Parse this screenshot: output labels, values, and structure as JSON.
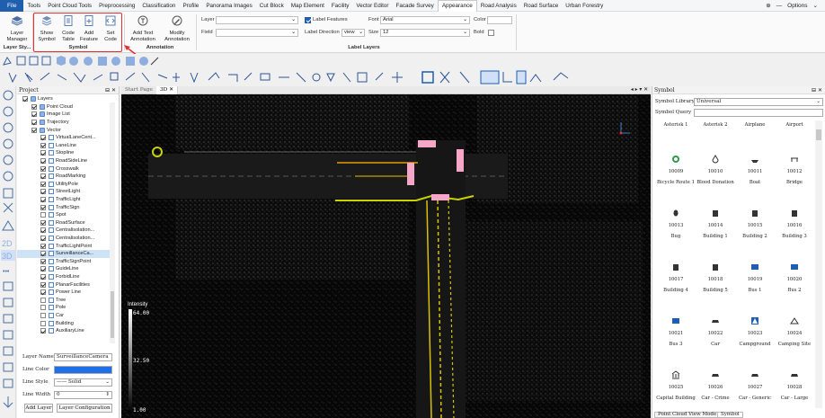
{
  "menubar": {
    "file": "File",
    "items": [
      "Tools",
      "Point Cloud Tools",
      "Preprocessing",
      "Classification",
      "Profile",
      "Panorama Images",
      "Cut Block",
      "Map Element",
      "Facility",
      "Vector Editor",
      "Facade Survey",
      "Appearance",
      "Road Analysis",
      "Road Surface",
      "Urban Forestry"
    ],
    "active": "Appearance",
    "options": "Options"
  },
  "ribbon": {
    "layer_manager": "Layer Manager",
    "layer_group": "Layer Sty...",
    "show_symbol": "Show Symbol",
    "code_table": "Code Table",
    "add_feature": "Add Feature",
    "set_code": "Set Code",
    "symbol_group": "Symbol",
    "add_text_annotation": "Add Text Annotation",
    "modify_annotation": "Modify Annotation",
    "annotation_group": "Annotation",
    "layer_label": "Layer",
    "field_label": "Field",
    "label_features": "Label Features",
    "label_direction": "Label Direction",
    "label_direction_value": "view",
    "font_label": "Font",
    "font_value": "Arial",
    "size_label": "Size",
    "size_value": "12",
    "color_label": "Color",
    "bold_label": "Bold",
    "layers_group": "Label Layers"
  },
  "project": {
    "title": "Project",
    "tree": [
      {
        "label": "Layers",
        "indent": 0,
        "checked": true
      },
      {
        "label": "Point Cloud",
        "indent": 1,
        "checked": true
      },
      {
        "label": "Image List",
        "indent": 1,
        "checked": true
      },
      {
        "label": "Trajectory",
        "indent": 1,
        "checked": true
      },
      {
        "label": "Vector",
        "indent": 1,
        "checked": true
      },
      {
        "label": "VirtualLaneCent...",
        "indent": 2,
        "checked": true
      },
      {
        "label": "LaneLine",
        "indent": 2,
        "checked": true
      },
      {
        "label": "Stopline",
        "indent": 2,
        "checked": true
      },
      {
        "label": "RoadSideLine",
        "indent": 2,
        "checked": true
      },
      {
        "label": "Crosswalk",
        "indent": 2,
        "checked": true
      },
      {
        "label": "RoadMarking",
        "indent": 2,
        "checked": true
      },
      {
        "label": "UtilityPole",
        "indent": 2,
        "checked": true
      },
      {
        "label": "StreetLight",
        "indent": 2,
        "checked": true
      },
      {
        "label": "TrafficLight",
        "indent": 2,
        "checked": true
      },
      {
        "label": "TrafficSign",
        "indent": 2,
        "checked": true
      },
      {
        "label": "Spot",
        "indent": 2,
        "checked": false
      },
      {
        "label": "RoadSurface",
        "indent": 2,
        "checked": true
      },
      {
        "label": "Centralisolation...",
        "indent": 2,
        "checked": true
      },
      {
        "label": "Centralisolation...",
        "indent": 2,
        "checked": true
      },
      {
        "label": "TrafficLightPoint",
        "indent": 2,
        "checked": true
      },
      {
        "label": "SurveillanceCa...",
        "indent": 2,
        "checked": true,
        "selected": true
      },
      {
        "label": "TrafficSignPoint",
        "indent": 2,
        "checked": true
      },
      {
        "label": "GuideLine",
        "indent": 2,
        "checked": true
      },
      {
        "label": "ForbidLine",
        "indent": 2,
        "checked": true
      },
      {
        "label": "PlanarFacilities",
        "indent": 2,
        "checked": true
      },
      {
        "label": "Power Line",
        "indent": 2,
        "checked": true
      },
      {
        "label": "Tree",
        "indent": 2,
        "checked": false
      },
      {
        "label": "Pole",
        "indent": 2,
        "checked": false
      },
      {
        "label": "Car",
        "indent": 2,
        "checked": false
      },
      {
        "label": "Building",
        "indent": 2,
        "checked": false
      },
      {
        "label": "AuxiliaryLine",
        "indent": 2,
        "checked": true
      }
    ],
    "layer_name_label": "Layer Name",
    "layer_name_value": "SurveillanceCamera",
    "line_color_label": "Line Color",
    "line_color": "#1e6fe8",
    "line_style_label": "Line Style",
    "line_style_value": "—— Solid",
    "line_width_label": "Line Width",
    "line_width_value": "0",
    "add_layer": "Add Layer",
    "layer_config": "Layer Configuration"
  },
  "viewer": {
    "tabs": [
      "Start Page",
      "3D"
    ],
    "active_tab": "3D",
    "intensity_label": "Intensity",
    "scale_top": "64.00",
    "scale_mid": "32.50",
    "scale_bottom": "1.00"
  },
  "symbol": {
    "title": "Symbol",
    "library_label": "Symbol Library",
    "library_value": "Universal",
    "query_label": "Symbol Query",
    "items": [
      {
        "code": "",
        "name": "Asterisk 1",
        "icon": "asterisk-icon"
      },
      {
        "code": "",
        "name": "Asterisk 2",
        "icon": "asterisk-icon"
      },
      {
        "code": "",
        "name": "Airplane",
        "icon": "airplane-icon"
      },
      {
        "code": "",
        "name": "Airport",
        "icon": "airport-icon"
      },
      {
        "code": "10009",
        "name": "Bicycle Route 1",
        "icon": "bicycle-icon"
      },
      {
        "code": "10010",
        "name": "Blood Donation",
        "icon": "blood-icon"
      },
      {
        "code": "10011",
        "name": "Boat",
        "icon": "boat-icon"
      },
      {
        "code": "10012",
        "name": "Bridge",
        "icon": "bridge-icon"
      },
      {
        "code": "10013",
        "name": "Bug",
        "icon": "bug-icon"
      },
      {
        "code": "10014",
        "name": "Building 1",
        "icon": "building-icon"
      },
      {
        "code": "10015",
        "name": "Building 2",
        "icon": "building-icon"
      },
      {
        "code": "10016",
        "name": "Building 3",
        "icon": "building-icon"
      },
      {
        "code": "10017",
        "name": "Building 4",
        "icon": "building-icon"
      },
      {
        "code": "10018",
        "name": "Building 5",
        "icon": "building-icon"
      },
      {
        "code": "10019",
        "name": "Bus 1",
        "icon": "bus-icon"
      },
      {
        "code": "10020",
        "name": "Bus 2",
        "icon": "bus-icon"
      },
      {
        "code": "10021",
        "name": "Bus 3",
        "icon": "bus-icon"
      },
      {
        "code": "10022",
        "name": "Car",
        "icon": "car-icon"
      },
      {
        "code": "10023",
        "name": "Campground",
        "icon": "campground-icon"
      },
      {
        "code": "10024",
        "name": "Camping Site",
        "icon": "camping-icon"
      },
      {
        "code": "10025",
        "name": "Capital Building",
        "icon": "capital-icon"
      },
      {
        "code": "10026",
        "name": "Car - Crime",
        "icon": "car-icon"
      },
      {
        "code": "10027",
        "name": "Car - Generic",
        "icon": "car-icon"
      },
      {
        "code": "10028",
        "name": "Car - Large",
        "icon": "car-icon"
      }
    ],
    "bottom_tabs": [
      "Point Cloud View Mode",
      "Symbol"
    ]
  }
}
